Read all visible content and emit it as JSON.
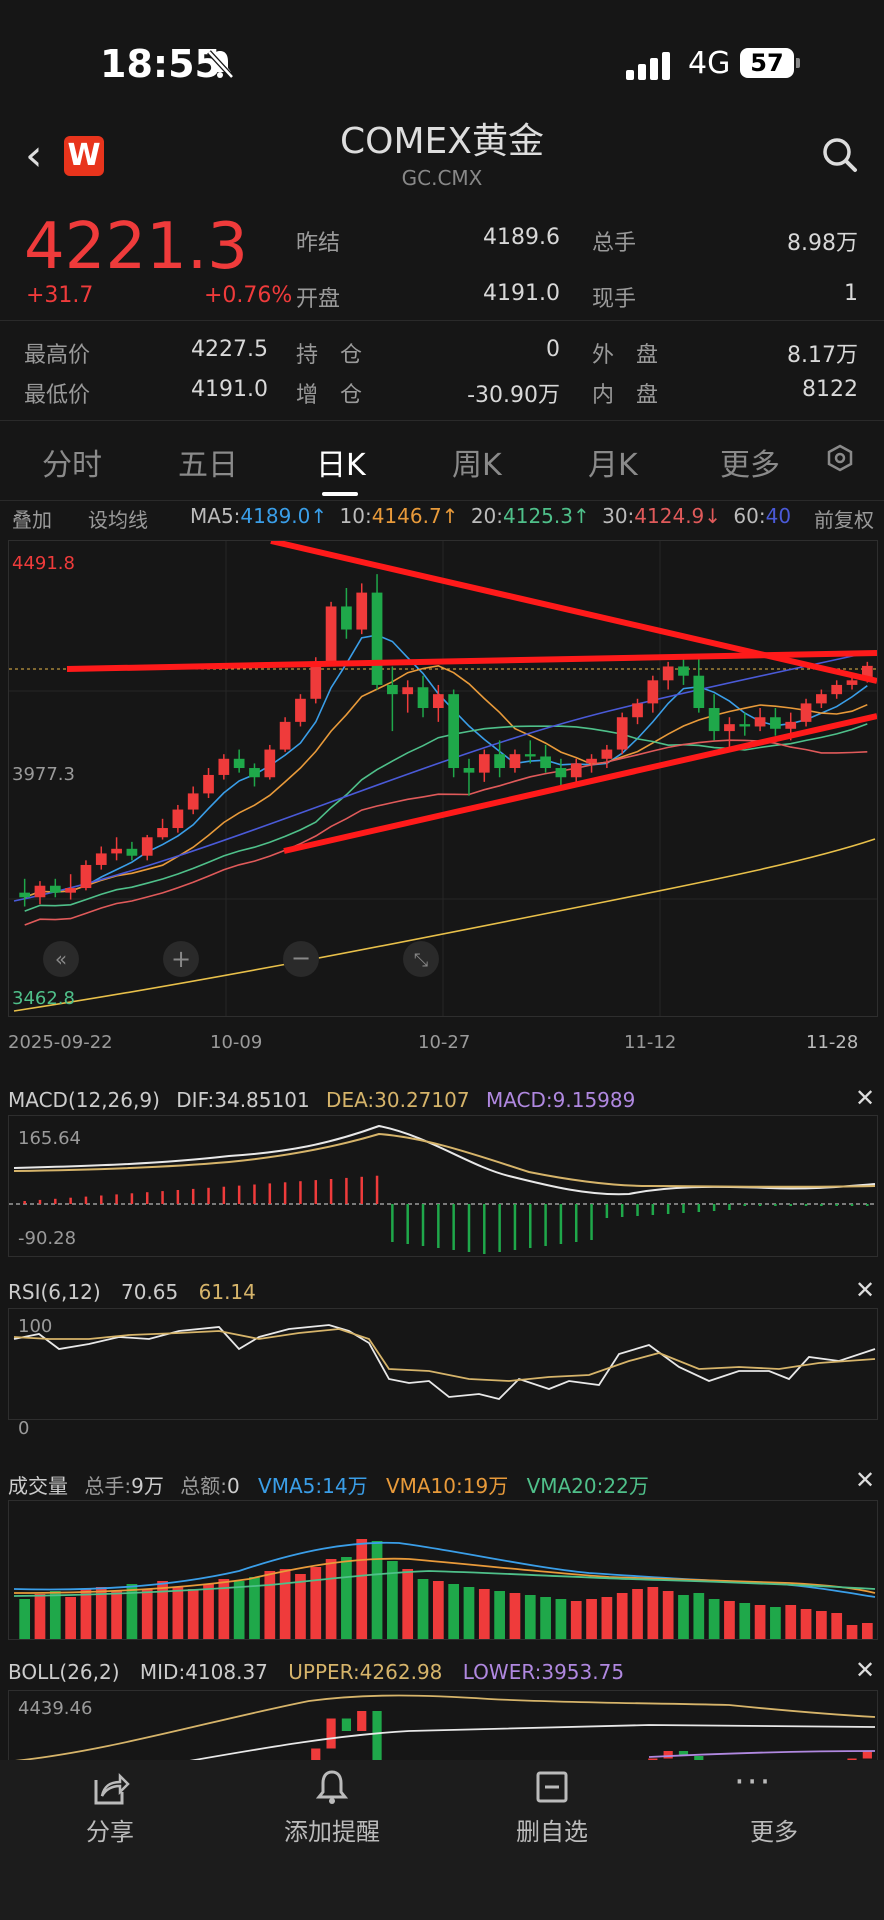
{
  "status_bar": {
    "time": "18:55",
    "network": "4G",
    "battery": "57"
  },
  "header": {
    "title": "COMEX黄金",
    "subtitle": "GC.CMX",
    "logo": "W"
  },
  "quote": {
    "price": "4221.3",
    "change": "+31.7",
    "change_pct": "+0.76%",
    "rows": [
      {
        "l1": "昨结",
        "v1": "4189.6",
        "l2": "总手",
        "v2": "8.98万"
      },
      {
        "l1": "开盘",
        "v1": "4191.0",
        "l2": "现手",
        "v2": "1"
      },
      {
        "l0": "最高价",
        "v0": "4227.5",
        "l1": "持　仓",
        "v1": "0",
        "l2": "外　盘",
        "v2": "8.17万"
      },
      {
        "l0": "最低价",
        "v0": "4191.0",
        "l1": "增　仓",
        "v1": "-30.90万",
        "l2": "内　盘",
        "v2": "8122"
      }
    ]
  },
  "tabs": [
    "分时",
    "五日",
    "日K",
    "周K",
    "月K",
    "更多"
  ],
  "active_tab": 2,
  "toolbar": {
    "overlay": "叠加",
    "set_ma": "设均线",
    "ma5_label": "MA5:",
    "ma5": "4189.0↑",
    "ma10_label": "10:",
    "ma10": "4146.7↑",
    "ma20_label": "20:",
    "ma20": "4125.3↑",
    "ma30_label": "30:",
    "ma30": "4124.9↓",
    "ma60_label": "60:",
    "ma60": "40",
    "adjust": "前复权"
  },
  "main_chart": {
    "y_top": "4491.8",
    "y_mid": "3977.3",
    "y_bottom": "3462.8",
    "x_labels": [
      "2025-09-22",
      "10-09",
      "10-27",
      "11-12",
      "11-28"
    ]
  },
  "macd": {
    "title": "MACD(12,26,9)",
    "dif": "DIF:34.85101",
    "dea": "DEA:30.27107",
    "macd": "MACD:9.15989",
    "y_top": "165.64",
    "y_bottom": "-90.28"
  },
  "rsi": {
    "title": "RSI(6,12)",
    "v1": "70.65",
    "v2": "61.14",
    "y_top": "100",
    "y_bottom": "0"
  },
  "volume": {
    "title": "成交量",
    "total_hands_label": "总手:",
    "total_hands": "9万",
    "total_amount_label": "总额:",
    "total_amount": "0",
    "vma5": "VMA5:14万",
    "vma10": "VMA10:19万",
    "vma20": "VMA20:22万"
  },
  "boll": {
    "title": "BOLL(26,2)",
    "mid": "MID:4108.37",
    "upper": "UPPER:4262.98",
    "lower": "LOWER:3953.75",
    "y_top": "4439.46"
  },
  "bottom_nav": [
    "分享",
    "添加提醒",
    "删自选",
    "更多"
  ],
  "colors": {
    "up": "#ef3b3b",
    "down": "#1fa84a",
    "ma5": "#3a9ee8",
    "ma10": "#e89a3a",
    "ma20": "#4fc08a",
    "ma30": "#e05a5a",
    "ma60": "#4a5ad8"
  },
  "chart_data": {
    "type": "candlestick",
    "ylim": [
      3462.8,
      4491.8
    ],
    "candles": [
      [
        3730,
        3760,
        3700,
        3720
      ],
      [
        3720,
        3755,
        3705,
        3745
      ],
      [
        3745,
        3760,
        3720,
        3730
      ],
      [
        3730,
        3770,
        3715,
        3740
      ],
      [
        3740,
        3800,
        3735,
        3790
      ],
      [
        3790,
        3830,
        3780,
        3815
      ],
      [
        3815,
        3850,
        3800,
        3825
      ],
      [
        3825,
        3840,
        3800,
        3810
      ],
      [
        3810,
        3855,
        3800,
        3850
      ],
      [
        3850,
        3890,
        3845,
        3870
      ],
      [
        3870,
        3920,
        3860,
        3910
      ],
      [
        3910,
        3960,
        3900,
        3945
      ],
      [
        3945,
        4000,
        3935,
        3985
      ],
      [
        3985,
        4030,
        3975,
        4020
      ],
      [
        4020,
        4040,
        3990,
        4000
      ],
      [
        4000,
        4010,
        3960,
        3980
      ],
      [
        3980,
        4050,
        3975,
        4040
      ],
      [
        4040,
        4110,
        4035,
        4100
      ],
      [
        4100,
        4160,
        4090,
        4150
      ],
      [
        4150,
        4240,
        4140,
        4230
      ],
      [
        4230,
        4360,
        4220,
        4350
      ],
      [
        4350,
        4390,
        4280,
        4300
      ],
      [
        4300,
        4400,
        4290,
        4380
      ],
      [
        4380,
        4420,
        4170,
        4180
      ],
      [
        4180,
        4220,
        4080,
        4160
      ],
      [
        4160,
        4190,
        4120,
        4175
      ],
      [
        4175,
        4200,
        4110,
        4130
      ],
      [
        4130,
        4180,
        4100,
        4160
      ],
      [
        4160,
        4170,
        3980,
        4000
      ],
      [
        4000,
        4020,
        3940,
        3990
      ],
      [
        3990,
        4040,
        3970,
        4030
      ],
      [
        4030,
        4060,
        3980,
        4000
      ],
      [
        4000,
        4040,
        3990,
        4030
      ],
      [
        4030,
        4060,
        4010,
        4025
      ],
      [
        4025,
        4050,
        3990,
        4000
      ],
      [
        4000,
        4020,
        3960,
        3980
      ],
      [
        3980,
        4020,
        3970,
        4010
      ],
      [
        4010,
        4030,
        3990,
        4020
      ],
      [
        4020,
        4050,
        4000,
        4040
      ],
      [
        4040,
        4120,
        4030,
        4110
      ],
      [
        4110,
        4150,
        4095,
        4140
      ],
      [
        4140,
        4200,
        4120,
        4190
      ],
      [
        4190,
        4230,
        4170,
        4220
      ],
      [
        4220,
        4240,
        4180,
        4200
      ],
      [
        4200,
        4240,
        4120,
        4130
      ],
      [
        4130,
        4160,
        4060,
        4080
      ],
      [
        4080,
        4110,
        4040,
        4095
      ],
      [
        4095,
        4120,
        4070,
        4090
      ],
      [
        4090,
        4130,
        4080,
        4110
      ],
      [
        4110,
        4130,
        4070,
        4085
      ],
      [
        4085,
        4120,
        4060,
        4100
      ],
      [
        4100,
        4150,
        4090,
        4140
      ],
      [
        4140,
        4170,
        4130,
        4160
      ],
      [
        4160,
        4190,
        4150,
        4180
      ],
      [
        4180,
        4200,
        4170,
        4190
      ],
      [
        4190,
        4230,
        4185,
        4221.3
      ]
    ]
  }
}
